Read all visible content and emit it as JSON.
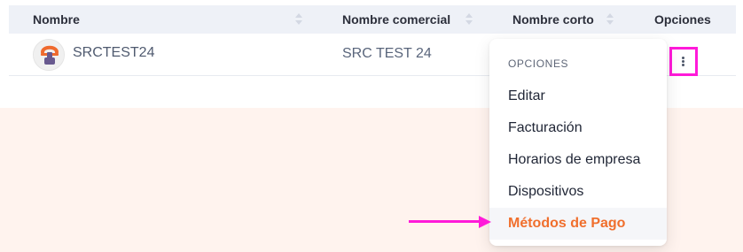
{
  "table": {
    "headers": {
      "nombre": "Nombre",
      "nombre_comercial": "Nombre comercial",
      "nombre_corto": "Nombre corto",
      "opciones": "Opciones"
    },
    "rows": [
      {
        "nombre": "SRCTEST24",
        "nombre_comercial": "SRC TEST 24",
        "nombre_corto": ""
      }
    ]
  },
  "dropdown": {
    "title": "OPCIONES",
    "items": [
      {
        "label": "Editar"
      },
      {
        "label": "Facturación"
      },
      {
        "label": "Horarios de empresa"
      },
      {
        "label": "Dispositivos"
      },
      {
        "label": "Métodos de Pago",
        "active": true
      }
    ]
  },
  "icons": {
    "avatar": "company-logo-icon",
    "sort": "sort-icon",
    "options": "kebab-menu-icon",
    "annotation": "arrow-right-icon"
  },
  "colors": {
    "header_background": "#eef1f7",
    "page_background": "#fff3ee",
    "accent": "#f06f2d",
    "annotation": "#ff1ad9"
  }
}
